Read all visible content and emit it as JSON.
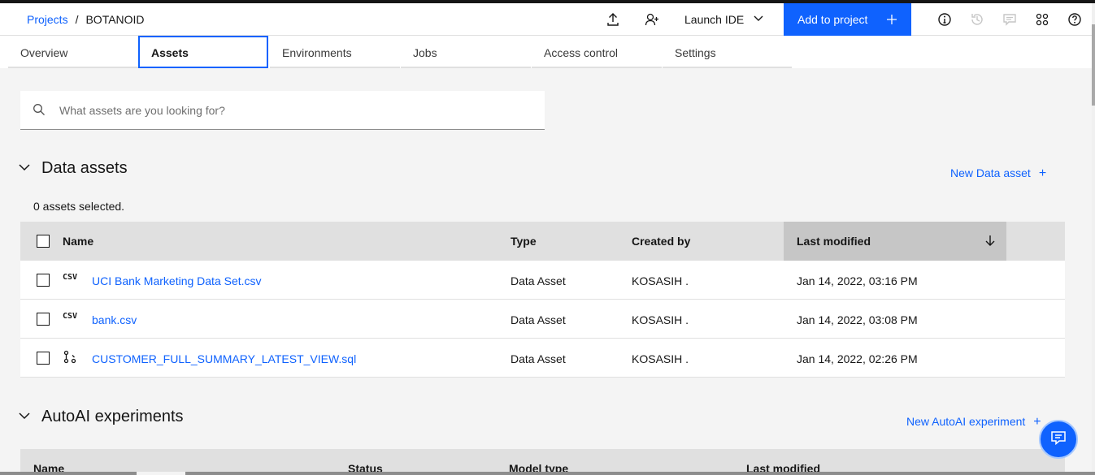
{
  "breadcrumb": {
    "projects": "Projects",
    "separator": "/",
    "current": "BOTANOID"
  },
  "header": {
    "launch_ide": "Launch IDE",
    "add_to_project": "Add to project",
    "icons": [
      "upload-icon",
      "add-collaborator-icon",
      "chevron-down-icon",
      "plus-icon",
      "info-icon",
      "history-icon",
      "comment-icon",
      "apps-icon",
      "help-icon"
    ]
  },
  "tabs": [
    {
      "label": "Overview"
    },
    {
      "label": "Assets",
      "active": true
    },
    {
      "label": "Environments"
    },
    {
      "label": "Jobs"
    },
    {
      "label": "Access control"
    },
    {
      "label": "Settings"
    }
  ],
  "search": {
    "placeholder": "What assets are you looking for?"
  },
  "data_assets": {
    "title": "Data assets",
    "new_label": "New Data asset",
    "selected_text": "0 assets selected.",
    "columns": {
      "name": "Name",
      "type": "Type",
      "created_by": "Created by",
      "last_modified": "Last modified"
    },
    "rows": [
      {
        "icon": "CSV",
        "name": "UCI Bank Marketing Data Set.csv",
        "type": "Data Asset",
        "created_by": "KOSASIH .",
        "last_modified": "Jan 14, 2022, 03:16 PM"
      },
      {
        "icon": "CSV",
        "name": "bank.csv",
        "type": "Data Asset",
        "created_by": "KOSASIH .",
        "last_modified": "Jan 14, 2022, 03:08 PM"
      },
      {
        "icon": "query-icon",
        "name": "CUSTOMER_FULL_SUMMARY_LATEST_VIEW.sql",
        "type": "Data Asset",
        "created_by": "KOSASIH .",
        "last_modified": "Jan 14, 2022, 02:26 PM"
      }
    ]
  },
  "autoai": {
    "title": "AutoAI experiments",
    "new_label": "New AutoAI experiment",
    "columns": {
      "name": "Name",
      "status": "Status",
      "model_type": "Model type",
      "last_modified": "Last modified"
    }
  },
  "colors": {
    "accent": "#0f62fe",
    "background": "#f4f4f4",
    "header_row": "#e0e0e0"
  }
}
